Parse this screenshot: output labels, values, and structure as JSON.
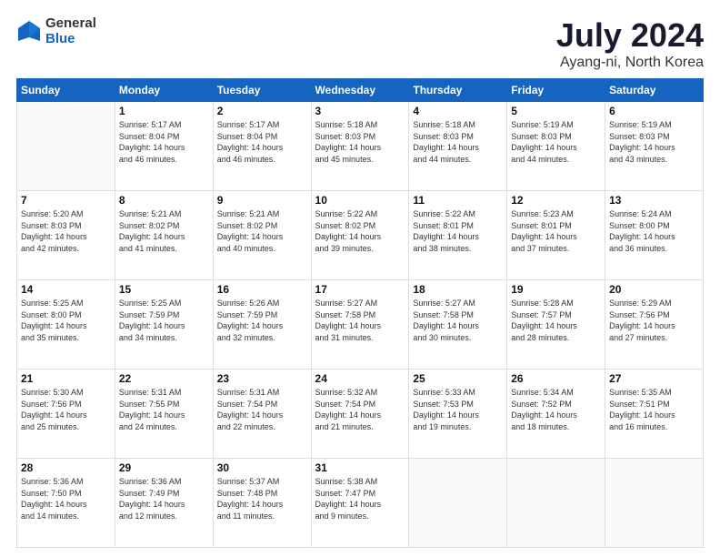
{
  "logo": {
    "general": "General",
    "blue": "Blue"
  },
  "title": "July 2024",
  "subtitle": "Ayang-ni, North Korea",
  "days_header": [
    "Sunday",
    "Monday",
    "Tuesday",
    "Wednesday",
    "Thursday",
    "Friday",
    "Saturday"
  ],
  "weeks": [
    [
      {
        "day": "",
        "info": ""
      },
      {
        "day": "1",
        "info": "Sunrise: 5:17 AM\nSunset: 8:04 PM\nDaylight: 14 hours\nand 46 minutes."
      },
      {
        "day": "2",
        "info": "Sunrise: 5:17 AM\nSunset: 8:04 PM\nDaylight: 14 hours\nand 46 minutes."
      },
      {
        "day": "3",
        "info": "Sunrise: 5:18 AM\nSunset: 8:03 PM\nDaylight: 14 hours\nand 45 minutes."
      },
      {
        "day": "4",
        "info": "Sunrise: 5:18 AM\nSunset: 8:03 PM\nDaylight: 14 hours\nand 44 minutes."
      },
      {
        "day": "5",
        "info": "Sunrise: 5:19 AM\nSunset: 8:03 PM\nDaylight: 14 hours\nand 44 minutes."
      },
      {
        "day": "6",
        "info": "Sunrise: 5:19 AM\nSunset: 8:03 PM\nDaylight: 14 hours\nand 43 minutes."
      }
    ],
    [
      {
        "day": "7",
        "info": "Sunrise: 5:20 AM\nSunset: 8:03 PM\nDaylight: 14 hours\nand 42 minutes."
      },
      {
        "day": "8",
        "info": "Sunrise: 5:21 AM\nSunset: 8:02 PM\nDaylight: 14 hours\nand 41 minutes."
      },
      {
        "day": "9",
        "info": "Sunrise: 5:21 AM\nSunset: 8:02 PM\nDaylight: 14 hours\nand 40 minutes."
      },
      {
        "day": "10",
        "info": "Sunrise: 5:22 AM\nSunset: 8:02 PM\nDaylight: 14 hours\nand 39 minutes."
      },
      {
        "day": "11",
        "info": "Sunrise: 5:22 AM\nSunset: 8:01 PM\nDaylight: 14 hours\nand 38 minutes."
      },
      {
        "day": "12",
        "info": "Sunrise: 5:23 AM\nSunset: 8:01 PM\nDaylight: 14 hours\nand 37 minutes."
      },
      {
        "day": "13",
        "info": "Sunrise: 5:24 AM\nSunset: 8:00 PM\nDaylight: 14 hours\nand 36 minutes."
      }
    ],
    [
      {
        "day": "14",
        "info": "Sunrise: 5:25 AM\nSunset: 8:00 PM\nDaylight: 14 hours\nand 35 minutes."
      },
      {
        "day": "15",
        "info": "Sunrise: 5:25 AM\nSunset: 7:59 PM\nDaylight: 14 hours\nand 34 minutes."
      },
      {
        "day": "16",
        "info": "Sunrise: 5:26 AM\nSunset: 7:59 PM\nDaylight: 14 hours\nand 32 minutes."
      },
      {
        "day": "17",
        "info": "Sunrise: 5:27 AM\nSunset: 7:58 PM\nDaylight: 14 hours\nand 31 minutes."
      },
      {
        "day": "18",
        "info": "Sunrise: 5:27 AM\nSunset: 7:58 PM\nDaylight: 14 hours\nand 30 minutes."
      },
      {
        "day": "19",
        "info": "Sunrise: 5:28 AM\nSunset: 7:57 PM\nDaylight: 14 hours\nand 28 minutes."
      },
      {
        "day": "20",
        "info": "Sunrise: 5:29 AM\nSunset: 7:56 PM\nDaylight: 14 hours\nand 27 minutes."
      }
    ],
    [
      {
        "day": "21",
        "info": "Sunrise: 5:30 AM\nSunset: 7:56 PM\nDaylight: 14 hours\nand 25 minutes."
      },
      {
        "day": "22",
        "info": "Sunrise: 5:31 AM\nSunset: 7:55 PM\nDaylight: 14 hours\nand 24 minutes."
      },
      {
        "day": "23",
        "info": "Sunrise: 5:31 AM\nSunset: 7:54 PM\nDaylight: 14 hours\nand 22 minutes."
      },
      {
        "day": "24",
        "info": "Sunrise: 5:32 AM\nSunset: 7:54 PM\nDaylight: 14 hours\nand 21 minutes."
      },
      {
        "day": "25",
        "info": "Sunrise: 5:33 AM\nSunset: 7:53 PM\nDaylight: 14 hours\nand 19 minutes."
      },
      {
        "day": "26",
        "info": "Sunrise: 5:34 AM\nSunset: 7:52 PM\nDaylight: 14 hours\nand 18 minutes."
      },
      {
        "day": "27",
        "info": "Sunrise: 5:35 AM\nSunset: 7:51 PM\nDaylight: 14 hours\nand 16 minutes."
      }
    ],
    [
      {
        "day": "28",
        "info": "Sunrise: 5:36 AM\nSunset: 7:50 PM\nDaylight: 14 hours\nand 14 minutes."
      },
      {
        "day": "29",
        "info": "Sunrise: 5:36 AM\nSunset: 7:49 PM\nDaylight: 14 hours\nand 12 minutes."
      },
      {
        "day": "30",
        "info": "Sunrise: 5:37 AM\nSunset: 7:48 PM\nDaylight: 14 hours\nand 11 minutes."
      },
      {
        "day": "31",
        "info": "Sunrise: 5:38 AM\nSunset: 7:47 PM\nDaylight: 14 hours\nand 9 minutes."
      },
      {
        "day": "",
        "info": ""
      },
      {
        "day": "",
        "info": ""
      },
      {
        "day": "",
        "info": ""
      }
    ]
  ]
}
